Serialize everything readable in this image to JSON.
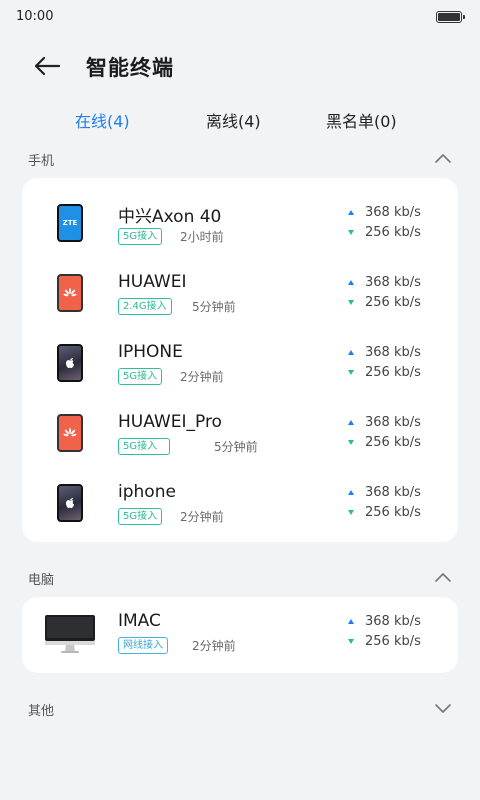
{
  "status": {
    "time": "10:00"
  },
  "header": {
    "title": "智能终端"
  },
  "tabs": [
    {
      "label": "在线(4)",
      "active": true
    },
    {
      "label": "离线(4)",
      "active": false
    },
    {
      "label": "黑名单(0)",
      "active": false
    }
  ],
  "sections": {
    "phones": {
      "title": "手机",
      "expanded": true,
      "devices": [
        {
          "name": "中兴Axon 40",
          "icon": "zte-phone-icon",
          "logo_text": "ZTE",
          "tag": "5G接入",
          "ago": "2小时前",
          "up": "368 kb/s",
          "down": "256 kb/s"
        },
        {
          "name": "HUAWEI",
          "icon": "huawei-phone-icon",
          "tag": "2.4G接入",
          "ago": "5分钟前",
          "up": "368 kb/s",
          "down": "256 kb/s"
        },
        {
          "name": "IPHONE",
          "icon": "iphone-icon",
          "tag": "5G接入",
          "ago": "2分钟前",
          "up": "368 kb/s",
          "down": "256 kb/s"
        },
        {
          "name": "HUAWEI_Pro",
          "icon": "huawei-phone-icon",
          "tag": "5G接入",
          "ago": "5分钟前",
          "up": "368 kb/s",
          "down": "256 kb/s"
        },
        {
          "name": "iphone",
          "icon": "iphone-icon",
          "tag": "5G接入",
          "ago": "2分钟前",
          "up": "368 kb/s",
          "down": "256 kb/s"
        }
      ]
    },
    "computers": {
      "title": "电脑",
      "expanded": true,
      "devices": [
        {
          "name": "IMAC",
          "icon": "imac-icon",
          "tag": "网线接入",
          "ago": "2分钟前",
          "up": "368 kb/s",
          "down": "256 kb/s"
        }
      ]
    },
    "other": {
      "title": "其他",
      "expanded": false
    }
  },
  "colors": {
    "accent": "#1e7ef2",
    "up_arrow": "#1e7ef2",
    "down_arrow": "#25c08f",
    "tag_green": "#2cc09a",
    "tag_blue": "#3fb6e0"
  }
}
